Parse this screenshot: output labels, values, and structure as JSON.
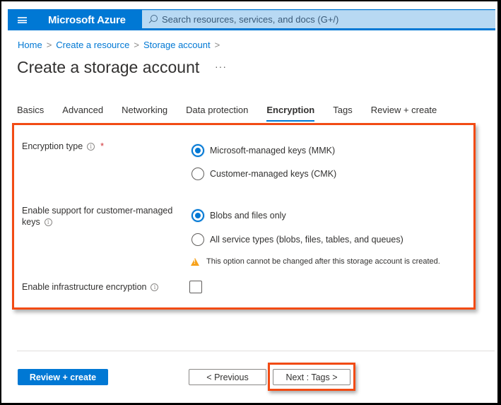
{
  "header": {
    "menu_icon": "hamburger-icon",
    "brand": "Microsoft Azure",
    "search_placeholder": "Search resources, services, and docs (G+/)",
    "search_icon": "search-icon"
  },
  "breadcrumb": [
    {
      "label": "Home"
    },
    {
      "label": "Create a resource"
    },
    {
      "label": "Storage account"
    }
  ],
  "breadcrumb_separator": ">",
  "page": {
    "title": "Create a storage account",
    "more_label": "···"
  },
  "tabs": [
    {
      "label": "Basics",
      "active": false
    },
    {
      "label": "Advanced",
      "active": false
    },
    {
      "label": "Networking",
      "active": false
    },
    {
      "label": "Data protection",
      "active": false
    },
    {
      "label": "Encryption",
      "active": true
    },
    {
      "label": "Tags",
      "active": false
    },
    {
      "label": "Review + create",
      "active": false
    }
  ],
  "form": {
    "encryption_type": {
      "label": "Encryption type",
      "required_mark": "*",
      "info_icon": "i",
      "options": [
        {
          "label": "Microsoft-managed keys (MMK)",
          "selected": true
        },
        {
          "label": "Customer-managed keys (CMK)",
          "selected": false
        }
      ]
    },
    "cmk_support": {
      "label_line1": "Enable support for customer-managed",
      "label_line2": "keys",
      "info_icon": "i",
      "options": [
        {
          "label": "Blobs and files only",
          "selected": true
        },
        {
          "label": "All service types (blobs, files, tables, and queues)",
          "selected": false
        }
      ],
      "warning": "This option cannot be changed after this storage account is created."
    },
    "infrastructure_encryption": {
      "label": "Enable infrastructure encryption",
      "info_icon": "i",
      "checked": false
    }
  },
  "footer": {
    "review_create": "Review + create",
    "previous": "< Previous",
    "next": "Next : Tags >"
  },
  "colors": {
    "azure_blue": "#0078d4",
    "highlight_orange": "#f24b14",
    "warning_amber": "#f7a21b",
    "required_red": "#d13438"
  }
}
